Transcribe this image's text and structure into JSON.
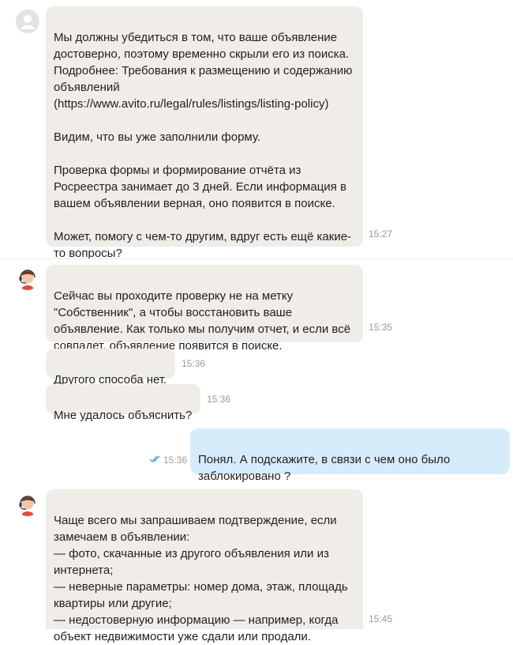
{
  "messages": [
    {
      "sender": "system",
      "text": "Мы должны убедиться в том, что ваше объявление\nдостоверно, поэтому временно скрыли его из поиска.\nПодробнее: Требования к размещению и содержанию\nобъявлений\n(https://www.avito.ru/legal/rules/listings/listing-policy)\n\nВидим, что вы уже заполнили форму.\n\nПроверка формы и формирование отчёта из\nРосреестра занимает до 3 дней. Если информация в\nвашем объявлении верная, оно появится в поиске.\n\nМожет, помогу с чем-то другим, вдруг есть ещё какие-\nто вопросы?",
      "time": "15:27"
    },
    {
      "sender": "support",
      "text": "Сейчас вы проходите проверку не на метку\n\"Собственник\", а чтобы восстановить ваше\nобъявление. Как только мы получим отчет, и если всё\nсовпадет, объявление появится в поиске.",
      "time": "15:35"
    },
    {
      "sender": "support",
      "text": "Другого способа нет.",
      "time": "15:36"
    },
    {
      "sender": "support",
      "text": "Мне удалось объяснить?",
      "time": "15:36"
    },
    {
      "sender": "user",
      "text": "Понял. А подскажите, в связи с чем оно было\nзаблокировано ?",
      "time": "15:36",
      "status": "read"
    },
    {
      "sender": "support",
      "text": "Чаще всего мы запрашиваем подтверждение, если\nзамечаем в объявлении:\n— фото, скачанные из другого объявления или из\nинтернета;\n— неверные параметры: номер дома, этаж, площадь\nквартиры или другие;\n— недостоверную информацию — например, когда\nобъект недвижимости уже сдали или продали.",
      "time": "15:45"
    }
  ],
  "colors": {
    "incoming_bubble": "#f0ede8",
    "outgoing_bubble": "#d6ecfb",
    "read_ticks": "#3d9be9"
  }
}
